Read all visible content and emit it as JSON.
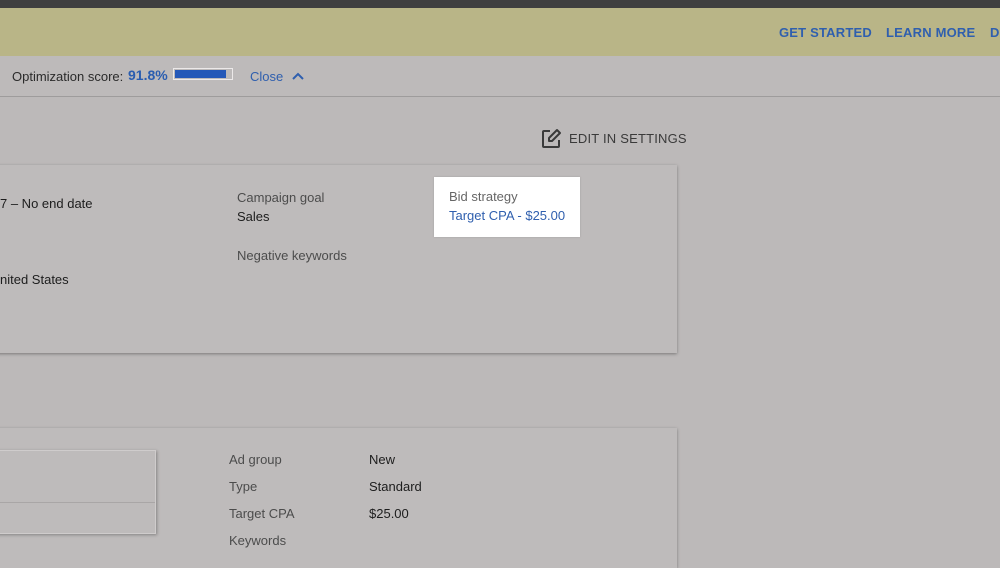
{
  "promo": {
    "links": [
      "GET STARTED",
      "LEARN MORE",
      "DI"
    ]
  },
  "optimization": {
    "label": "Optimization score:",
    "value": "91.8%",
    "score_fraction": 0.918,
    "close_label": "Close"
  },
  "edit_settings_label": "EDIT IN SETTINGS",
  "settings_card": {
    "dates_value": "7 – No end date",
    "location_value": "nited States",
    "campaign_goal_label": "Campaign goal",
    "campaign_goal_value": "Sales",
    "negative_keywords_label": "Negative keywords",
    "bid_strategy_label": "Bid strategy",
    "bid_strategy_value": "Target CPA - $25.00"
  },
  "adgroup_card": {
    "rows": [
      {
        "label": "Ad group",
        "value": "New"
      },
      {
        "label": "Type",
        "value": "Standard"
      },
      {
        "label": "Target CPA",
        "value": "$25.00"
      },
      {
        "label": "Keywords",
        "value": ""
      }
    ]
  },
  "colors": {
    "accent": "#2f5fae",
    "progress_fill": "#2458b8",
    "promo_bg": "#b9b587"
  }
}
